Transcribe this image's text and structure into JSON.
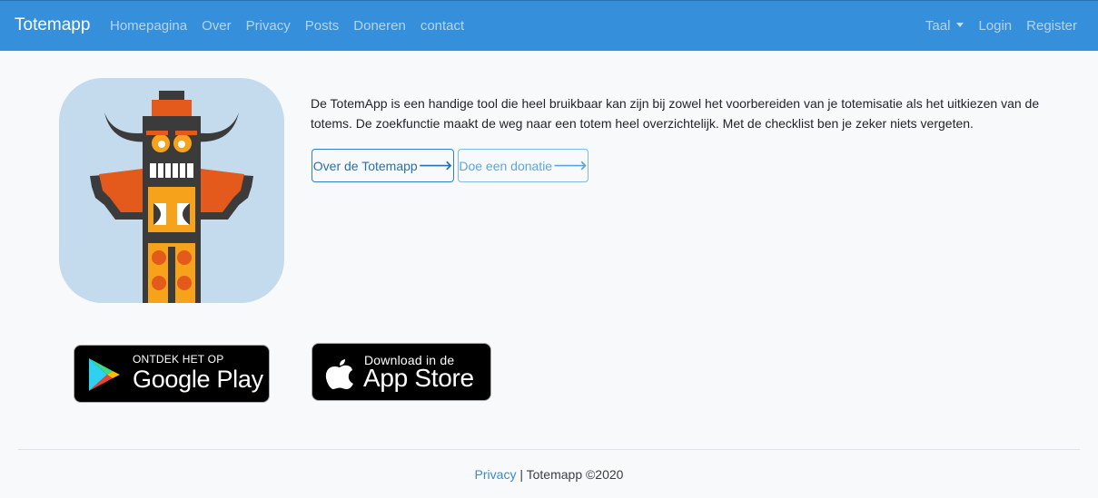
{
  "navbar": {
    "brand": "Totemapp",
    "links": [
      "Homepagina",
      "Over",
      "Privacy",
      "Posts",
      "Doneren",
      "contact"
    ],
    "language": "Taal",
    "login": "Login",
    "register": "Register"
  },
  "intro": {
    "text": "De TotemApp is een handige tool die heel bruikbaar kan zijn bij zowel het voorbereiden van je totemisatie als het uitkiezen van de totems. De zoekfunctie maakt de weg naar een totem heel overzichtelijk. Met de checklist ben je zeker niets vergeten.",
    "about_button": "Over de Totemapp",
    "donate_button": "Doe een donatie",
    "arrow": "🡒"
  },
  "badges": {
    "google_small": "ONTDEK HET OP",
    "google_big": "Google Play",
    "apple_small": "Download in de",
    "apple_big": "App Store"
  },
  "footer": {
    "privacy": "Privacy",
    "rest": " | Totemapp ©2020"
  },
  "colors": {
    "navbar": "#368fdb",
    "logo_background": "#c3dbed",
    "totem_dark": "#3b3b3b",
    "totem_orange": "#e35a1c",
    "totem_yellow": "#f7a21b"
  },
  "icons": [
    "totem-logo-icon",
    "google-play-icon",
    "apple-icon",
    "caret-down-icon",
    "arrow-right-icon"
  ]
}
